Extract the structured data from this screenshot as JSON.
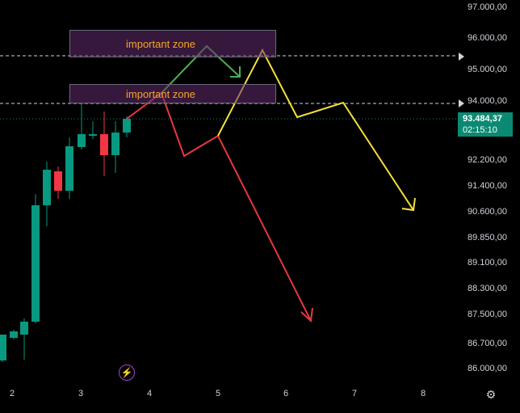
{
  "price_axis": {
    "labels": [
      "97.000,00",
      "96.000,00",
      "95.000,00",
      "94.000,00",
      "92.200,00",
      "91.400,00",
      "90.600,00",
      "89.850,00",
      "89.100,00",
      "88.300,00",
      "87.500,00",
      "86.700,00",
      "86.000,00"
    ]
  },
  "time_axis": {
    "labels": [
      "2",
      "3",
      "4",
      "5",
      "6",
      "7",
      "8"
    ]
  },
  "current_price": {
    "value": "93.484,37",
    "countdown": "02:15:10",
    "color": "#0b8a73"
  },
  "zones": [
    {
      "label": "important zone",
      "price_top": 96050,
      "price_bottom": 95450
    },
    {
      "label": "important zone",
      "price_top": 94280,
      "price_bottom": 93950
    }
  ],
  "level_lines": [
    95400,
    93900
  ],
  "colors": {
    "up_candle": "#089981",
    "down_candle": "#f23645",
    "zone_fill": "#622b6e",
    "zone_text": "#f5a623",
    "red_path": "#e8383f",
    "yellow_path": "#f4e13a",
    "green_path": "#4caf50"
  },
  "icons": {
    "lightning": "lightning-icon",
    "settings": "gear-icon"
  }
}
